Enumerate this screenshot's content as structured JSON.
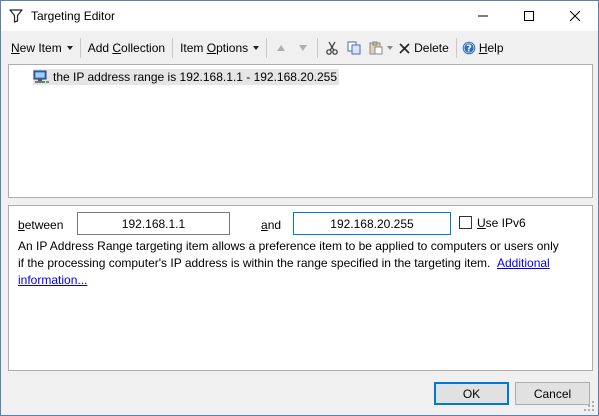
{
  "window": {
    "title": "Targeting Editor",
    "icon": "filter-icon"
  },
  "toolbar": {
    "new_item": {
      "pre": "",
      "accel": "N",
      "post": "ew Item"
    },
    "add_collection": {
      "pre": "Add ",
      "accel": "C",
      "post": "ollection"
    },
    "item_options": {
      "pre": "Item ",
      "accel": "O",
      "post": "ptions"
    },
    "move_up_icon": "arrow-up-icon",
    "move_down_icon": "arrow-down-icon",
    "cut_icon": "scissors-icon",
    "copy_icon": "copy-icon",
    "paste_icon": "paste-icon",
    "delete_label": "Delete",
    "help": {
      "pre": "",
      "accel": "H",
      "post": "elp"
    }
  },
  "tree": {
    "items": [
      {
        "label": "the IP address range is 192.168.1.1 - 192.168.20.255",
        "icon": "network-computer-icon",
        "selected": true
      }
    ]
  },
  "properties": {
    "between_label": {
      "pre": "",
      "accel": "b",
      "post": "etween"
    },
    "from_value": "192.168.1.1",
    "and_label": {
      "pre": "",
      "accel": "a",
      "post": "nd"
    },
    "to_value": "192.168.20.255",
    "ipv6_label": {
      "pre": "",
      "accel": "U",
      "post": "se IPv6"
    },
    "ipv6_checked": false,
    "description_line1": "An IP Address Range targeting item allows a preference item to be applied to computers or users only",
    "description_line2": "if the processing computer's IP address is within the range specified in the targeting item.",
    "link_text_1": "Additional",
    "link_text_2": "information..."
  },
  "buttons": {
    "ok": "OK",
    "cancel": "Cancel"
  },
  "colors": {
    "accent": "#0078d7",
    "link": "#0000ee",
    "selection": "#e5e5e5"
  }
}
